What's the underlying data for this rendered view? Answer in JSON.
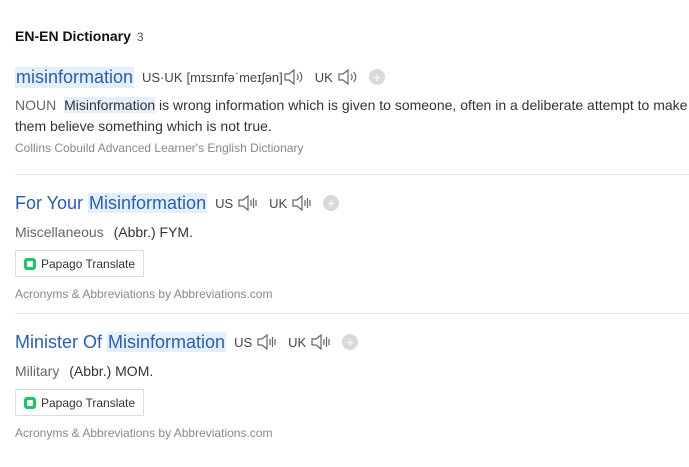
{
  "header": {
    "title": "EN-EN Dictionary",
    "count": "3"
  },
  "entries": [
    {
      "headword": "misinformation",
      "us_uk_label": "US·UK",
      "pronunciation": "[mɪsɪnfəˈmeɪʃən]",
      "uk_label": "UK",
      "definition": {
        "pos": "NOUN",
        "highlight": "Misinformation",
        "text": " is wrong information which is given to someone, often in a deliberate attempt to make them believe something which is not true."
      },
      "source": "Collins Cobuild Advanced Learner's English Dictionary"
    },
    {
      "headword_prefix": "For Your ",
      "headword_highlight": "Misinformation",
      "us_label": "US",
      "uk_label": "UK",
      "category": "Miscellaneous",
      "abbr": "(Abbr.) FYM.",
      "papago_label": "Papago Translate",
      "source": "Acronyms & Abbreviations by Abbreviations.com"
    },
    {
      "headword_prefix": "Minister Of ",
      "headword_highlight": "Misinformation",
      "us_label": "US",
      "uk_label": "UK",
      "category": "Military",
      "abbr": "(Abbr.) MOM.",
      "papago_label": "Papago Translate",
      "source": "Acronyms & Abbreviations by Abbreviations.com"
    }
  ],
  "icons": {
    "speaker": "speaker-icon",
    "add": "add-icon",
    "papago": "papago-icon"
  },
  "colors": {
    "headword": "#2b5ead",
    "highlight": "#e3f0fb"
  }
}
